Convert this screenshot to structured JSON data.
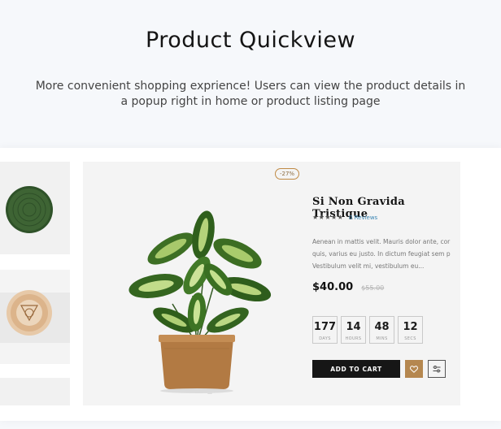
{
  "hero": {
    "title": "Product Quickview",
    "description": "More convenient shopping exprience! Users can view the product details in a popup right in home or product listing page"
  },
  "quickview": {
    "discount_badge": "-27%",
    "product_name": "Si Non Gravida Tristique",
    "rating_stars": "★★★★★",
    "rating": 0,
    "reviews_label": "0 Reviews",
    "description_lines": [
      "Aenean in mattis velit. Mauris dolor ante, cor",
      "quis, varius eu justo. In dictum feugiat sem p",
      "Vestibulum velit mi, vestibulum eu..."
    ],
    "price": "$40.00",
    "old_price": "$55.00",
    "countdown": [
      {
        "value": "177",
        "unit": "DAYS"
      },
      {
        "value": "14",
        "unit": "HOURS"
      },
      {
        "value": "48",
        "unit": "MINS"
      },
      {
        "value": "12",
        "unit": "SECS"
      }
    ],
    "add_to_cart_label": "ADD TO CART",
    "wishlist_icon": "heart-icon",
    "compare_icon": "sliders-icon"
  },
  "colors": {
    "accent": "#b5874f",
    "button_dark": "#161616",
    "review_link": "#3a86b4",
    "page_bg": "#f6f8fb"
  }
}
